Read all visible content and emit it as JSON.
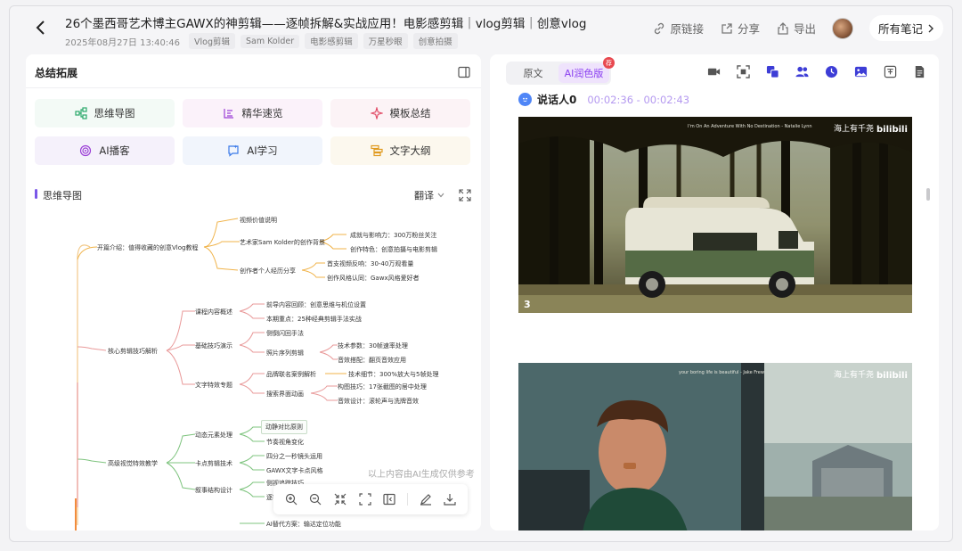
{
  "header": {
    "title": "26个墨西哥艺术博主GAWX的神剪辑——逐帧拆解&实战应用！电影感剪辑｜vlog剪辑｜创意vlog",
    "date": "2025年08月27日 13:40:46",
    "tags": [
      "Vlog剪辑",
      "Sam Kolder",
      "电影感剪辑",
      "万星秒眼",
      "创意拍摄"
    ],
    "actions": {
      "link": "原链接",
      "share": "分享",
      "export": "导出",
      "all_notes": "所有笔记"
    }
  },
  "left": {
    "title": "总结拓展",
    "tools": [
      "思维导图",
      "精华速览",
      "模板总结",
      "AI播客",
      "AI学习",
      "文字大纲"
    ],
    "mindmap_title": "思维导图",
    "translate": "翻译",
    "disclaimer": "以上内容由AI生成仅供参考",
    "mindmap": {
      "level1": [
        "开篇介绍：值得收藏的创意Vlog教程",
        "核心剪辑技巧解析",
        "高级视觉特效教学"
      ],
      "nodes": {
        "a1": "视频价值说明",
        "a2": "艺术家Sam Kolder的创作背景",
        "a2a": "成就与影响力：300万粉丝关注",
        "a2b": "创作特色：创意拍摄与电影剪辑",
        "a3": "创作者个人经历分享",
        "a3a": "首支视频反响：30-40万观看量",
        "a3b": "创作风格认同：Gawx风格爱好者",
        "b1": "课程内容概述",
        "b1a": "前导内容回顾：创意思维与机位设置",
        "b1b": "本期重点：25种经典剪辑手法实战",
        "b2": "基础技巧演示",
        "b2a": "侧倒闪回手法",
        "b2b": "照片序列剪辑",
        "b2b1": "技术参数：30帧速率处理",
        "b2b2": "音效搭配：翻页音效应用",
        "b3": "文字特效专题",
        "b3a": "品牌联名案例解析",
        "b3a1": "技术细节：300%放大与5帧处理",
        "b3b": "搜索界面动画",
        "b3b1": "构图技巧：17张截图的居中处理",
        "b3b2": "音效设计：滚轮声与洗牌音效",
        "c1": "动态元素处理",
        "c1a": "动静对比原则",
        "c1b": "节奏视角变化",
        "c2": "卡点剪辑技术",
        "c2a": "四分之一秒镜头运用",
        "c2b": "GAWX文字卡点风格",
        "c3": "叙事结构设计",
        "c3a": "侧视追踪技巧",
        "c3b": "逐字显示技巧",
        "c4": "AI替代方案：输达定位功能"
      }
    }
  },
  "right": {
    "tabs": [
      "原文",
      "AI润色版"
    ],
    "active_tab": 1,
    "badge": "荐",
    "speaker": "说话人0",
    "time_range": "00:02:36 - 00:02:43",
    "frames": [
      {
        "caption": "I'm On An Adventure With No Destination - Natalie Lynn",
        "watermark": "海上有千尧",
        "bili": "bilibili",
        "counter": "3"
      },
      {
        "caption": "your boring life is beautiful - Jake Frew",
        "watermark": "海上有千尧",
        "bili": "bilibili"
      }
    ]
  },
  "colors": {
    "accent": "#8a3ff0",
    "mindmap_green": "#7fc47f",
    "mindmap_orange": "#f0b34a",
    "mindmap_pink": "#e99a9a"
  }
}
